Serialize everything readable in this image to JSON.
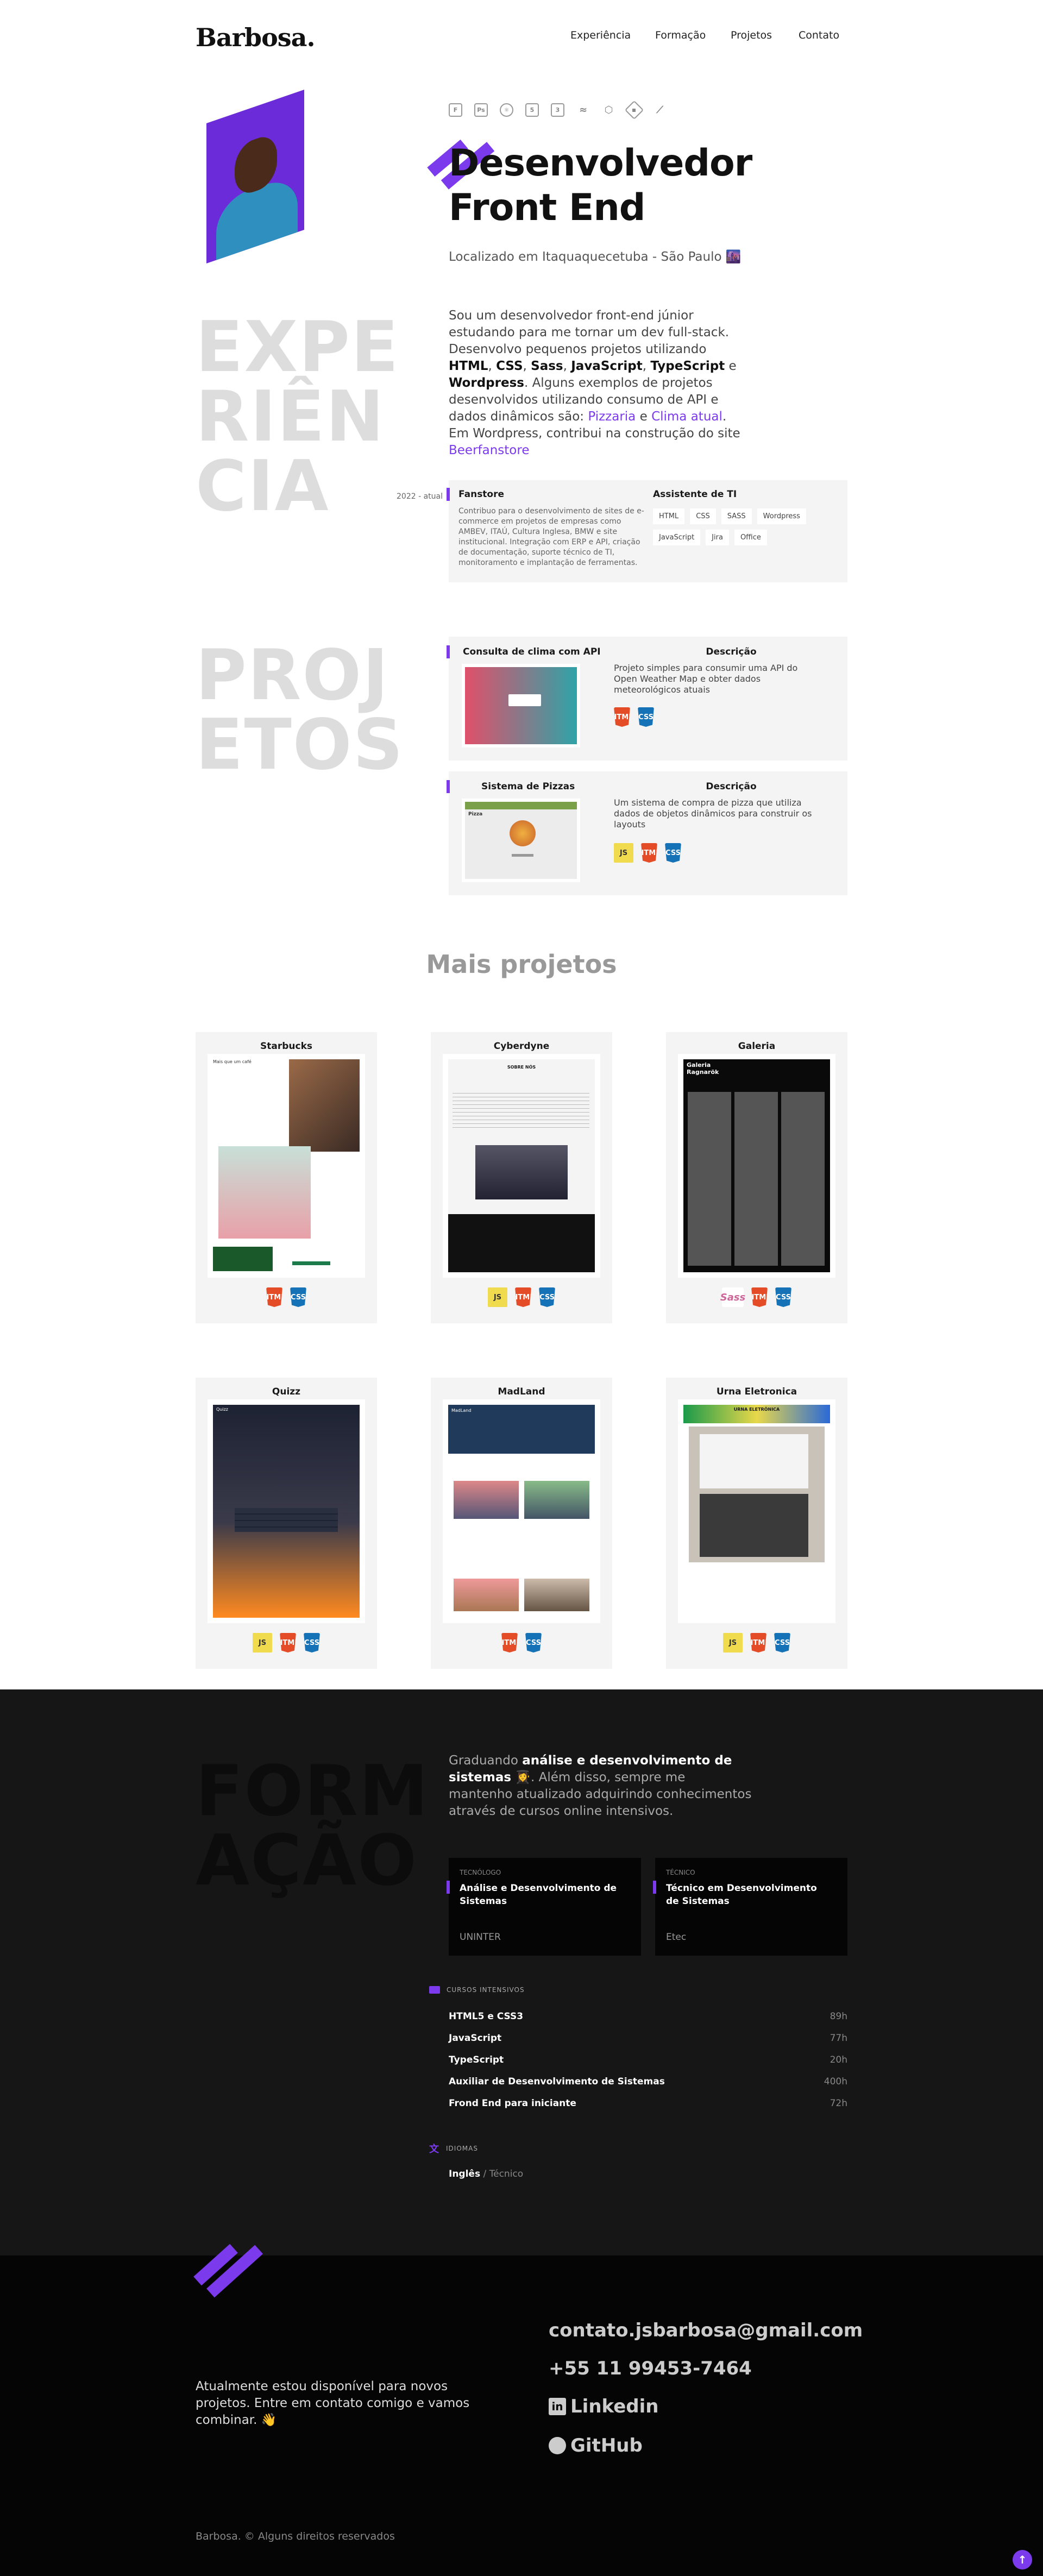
{
  "header": {
    "logo": "Barbosa.",
    "nav": [
      "Experiência",
      "Formação",
      "Projetos",
      "Contato"
    ]
  },
  "hero": {
    "tech_icons": [
      "figma-icon",
      "ps-icon",
      "react-icon",
      "html-icon",
      "css-icon",
      "sass-icon",
      "tailwind-icon",
      "node-icon",
      "git-icon",
      "vscode-icon"
    ],
    "title_line1": "Desenvolvedor",
    "title_line2": "Front End",
    "location": "Localizado em Itaquaquecetuba - São Paulo 🌆",
    "bio_1": "Sou um desenvolvedor front-end júnior estudando para me tornar um dev full-stack. Desenvolvo pequenos projetos utilizando ",
    "bio_html": "HTML",
    "bio_comma1": ", ",
    "bio_css": "CSS",
    "bio_comma2": ", ",
    "bio_sass": "Sass",
    "bio_comma3": ", ",
    "bio_js": "JavaScript",
    "bio_comma4": ", ",
    "bio_ts": "TypeScript",
    "bio_e": " e ",
    "bio_wp": "Wordpress",
    "bio_2": ". Alguns exemplos de projetos desenvolvidos utilizando consumo de API e dados dinâmicos são: ",
    "bio_link1": "Pizzaria",
    "bio_e2": " e ",
    "bio_link2": "Clima atual",
    "bio_3": ". Em Wordpress, contribui na construção do site ",
    "bio_link3": "Beerfanstore"
  },
  "experience": {
    "label_1": "EXPE",
    "label_2": "RIÊN",
    "label_3": "CIA",
    "year": "2022 - atual",
    "company": "Fanstore",
    "description": "Contribuo para o desenvolvimento de sites de e-commerce em projetos de empresas como AMBEV, ITAÚ, Cultura Inglesa, BMW e site institucional. Integração com ERP e API, criação de documentação, suporte técnico de TI, monitoramento e implantação de ferramentas.",
    "role": "Assistente de TI",
    "tags": [
      "HTML",
      "CSS",
      "SASS",
      "Wordpress",
      "JavaScript",
      "Jira",
      "Office"
    ]
  },
  "projects": {
    "label_1": "PROJ",
    "label_2": "ETOS",
    "items": [
      {
        "title": "Consulta de clima com API",
        "desc_heading": "Descrição",
        "desc": "Projeto simples para consumir uma API do Open Weather Map e obter dados meteorológicos atuais",
        "icons": [
          "HTML",
          "CSS"
        ]
      },
      {
        "title": "Sistema de Pizzas",
        "desc_heading": "Descrição",
        "desc": "Um sistema de compra de pizza que utiliza dados de objetos dinâmicos para construir os layouts",
        "icons": [
          "JS",
          "HTML",
          "CSS"
        ]
      }
    ],
    "more_title": "Mais projetos",
    "grid": [
      {
        "title": "Starbucks",
        "icons": [
          "HTML",
          "CSS"
        ]
      },
      {
        "title": "Cyberdyne",
        "icons": [
          "JS",
          "HTML",
          "CSS"
        ]
      },
      {
        "title": "Galeria",
        "icons": [
          "Sass",
          "HTML",
          "CSS"
        ]
      },
      {
        "title": "Quizz",
        "icons": [
          "JS",
          "HTML",
          "CSS"
        ]
      },
      {
        "title": "MadLand",
        "icons": [
          "HTML",
          "CSS"
        ]
      },
      {
        "title": "Urna Eletronica",
        "icons": [
          "JS",
          "HTML",
          "CSS"
        ]
      }
    ],
    "thumb_text": {
      "starbucks": "Mais que um café",
      "cyberdyne": "SOBRE NÓS",
      "galeria": "Galeria Ragnarök",
      "quizz": "Quizz",
      "madland": "MadLand",
      "urna_title": "URNA ELETRÔNICA",
      "pizza_title": "Pizza"
    }
  },
  "education": {
    "label_1": "FORM",
    "label_2": "AÇÃO",
    "text_1": "Graduando ",
    "text_bold": "análise e desenvolvimento de sistemas",
    "text_2": " 👩‍🎓. Além disso, sempre me mantenho atualizado adquirindo conhecimentos através de cursos online intensivos.",
    "cards": [
      {
        "level": "TECNÓLOGO",
        "name": "Análise e Desenvolvimento de Sistemas",
        "school": "UNINTER"
      },
      {
        "level": "TÉCNICO",
        "name": "Técnico em Desenvolvimento de Sistemas",
        "school": "Etec"
      }
    ],
    "courses_heading": "CURSOS INTENSIVOS",
    "courses": [
      {
        "name": "HTML5 e CSS3",
        "hours": "89h"
      },
      {
        "name": "JavaScript",
        "hours": "77h"
      },
      {
        "name": "TypeScript",
        "hours": "20h"
      },
      {
        "name": "Auxiliar de Desenvolvimento de Sistemas",
        "hours": "400h"
      },
      {
        "name": "Frond End para iniciante",
        "hours": "72h"
      }
    ],
    "languages_heading": "IDIOMAS",
    "language": "Inglês",
    "language_sep": " / ",
    "language_level": "Técnico"
  },
  "footer": {
    "text": "Atualmente estou disponível para novos projetos. Entre em contato comigo e vamos combinar. 👋",
    "email": "contato.jsbarbosa@gmail.com",
    "phone": "+55 11 99453-7464",
    "linkedin": "Linkedin",
    "github": "GitHub",
    "copyright": "Barbosa. © Alguns direitos reservados"
  },
  "colors": {
    "accent": "#7c3aed",
    "dark": "#161616",
    "footer": "#050505",
    "card": "#f4f4f4"
  }
}
